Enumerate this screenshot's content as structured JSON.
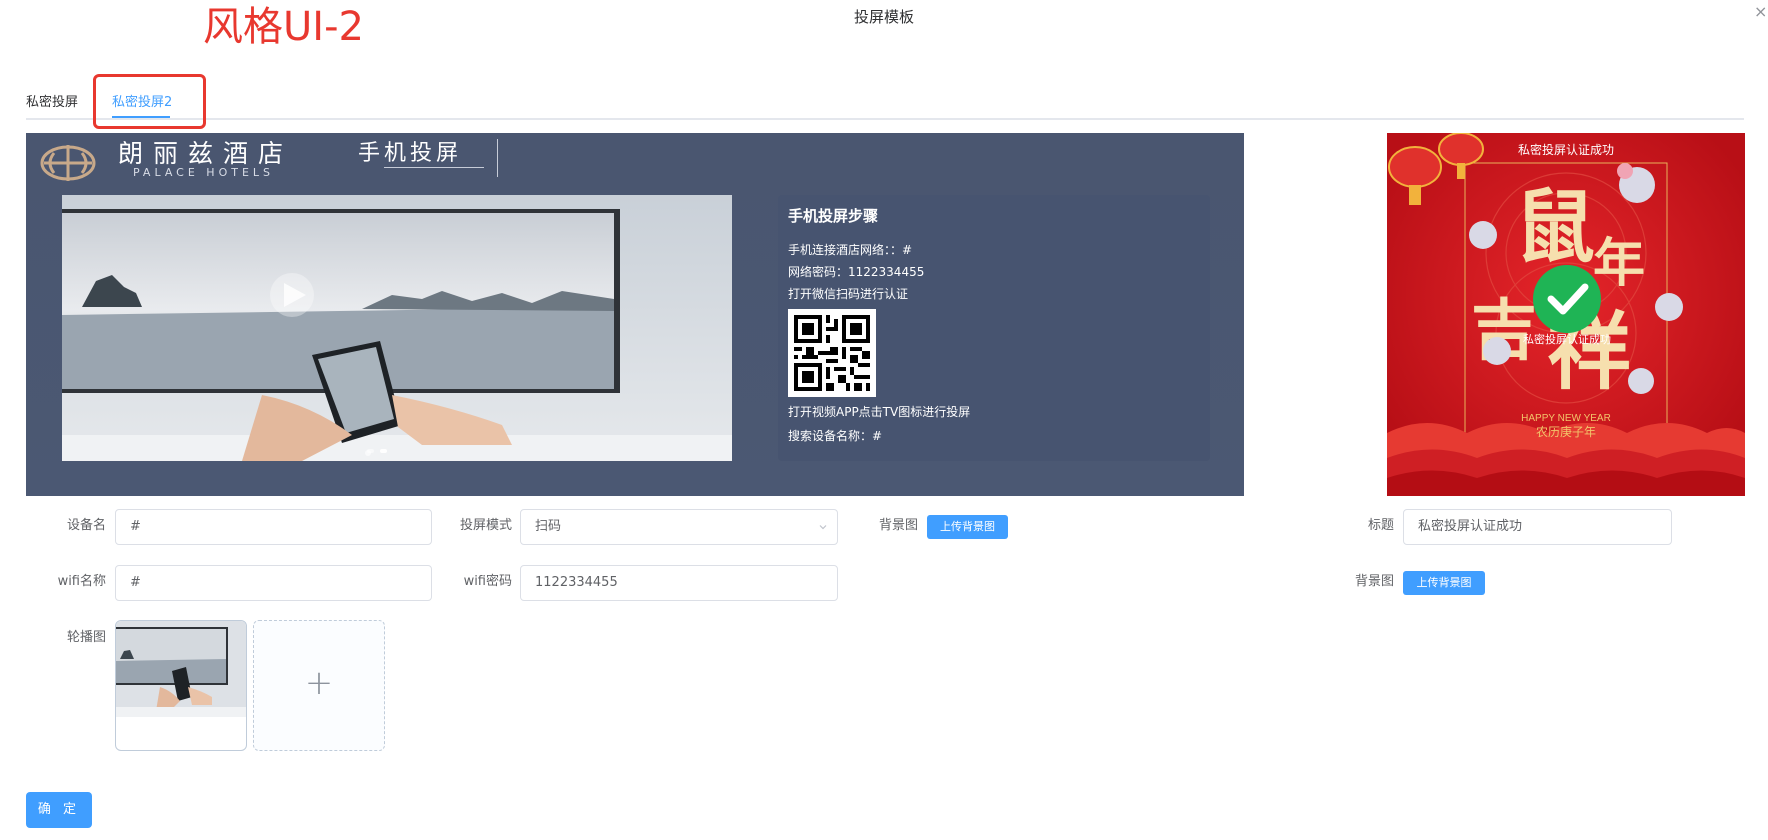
{
  "annotation": {
    "style_label": "风格UI-2"
  },
  "dialog": {
    "title": "投屏模板",
    "close_symbol": "×"
  },
  "tabs": [
    {
      "label": "私密投屏",
      "active": false
    },
    {
      "label": "私密投屏2",
      "active": true
    }
  ],
  "preview_left": {
    "hotel_name": "朗丽兹酒店",
    "hotel_name_en": "PALACE HOTELS",
    "mode_title": "手机投屏",
    "steps_title": "手机投屏步骤",
    "steps": [
      "手机连接酒店网络：：#",
      "网络密码：1122334455",
      "打开微信扫码进行认证"
    ],
    "steps_after_qr": [
      "打开视频APP点击TV图标进行投屏",
      "搜索设备名称：#"
    ],
    "carousel_slides": 2,
    "carousel_active": 1
  },
  "preview_right": {
    "title": "私密投屏认证成功",
    "check_label": "私密投屏认证成功",
    "greeting_text": "HAPPY NEW YEAR",
    "calendar_text": "农历庚子年",
    "big_chars": [
      "鼠",
      "年",
      "吉",
      "祥"
    ]
  },
  "form": {
    "device_name": {
      "label": "设备名",
      "value": "#"
    },
    "mode": {
      "label": "投屏模式",
      "value": "扫码"
    },
    "bg_left": {
      "label": "背景图",
      "button": "上传背景图"
    },
    "wifi_name": {
      "label": "wifi名称",
      "value": "#"
    },
    "wifi_pwd": {
      "label": "wifi密码",
      "value": "1122334455"
    },
    "carousel": {
      "label": "轮播图"
    },
    "title": {
      "label": "标题",
      "value": "私密投屏认证成功"
    },
    "bg_right": {
      "label": "背景图",
      "button": "上传背景图"
    },
    "confirm": "确 定"
  },
  "colors": {
    "primary": "#409eff",
    "annotation_red": "#e8382f",
    "preview_bg": "#4a5670",
    "festive_red": "#c8151b",
    "success_green": "#1fb455"
  }
}
